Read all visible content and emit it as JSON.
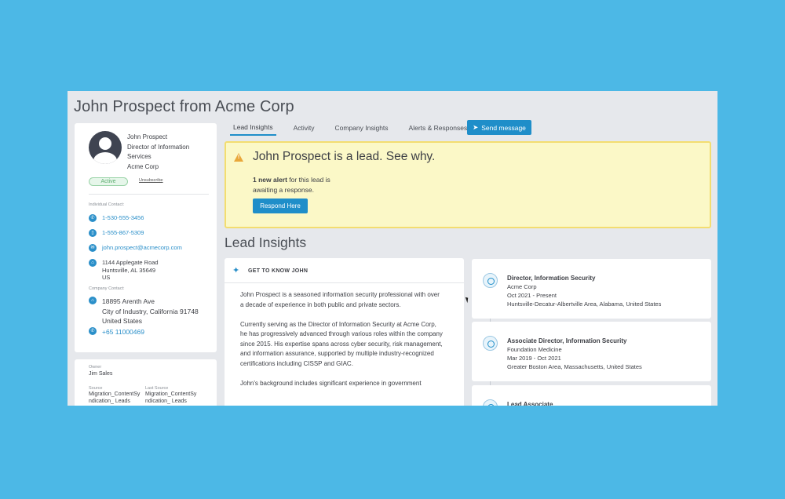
{
  "header": {
    "title": "John Prospect from Acme Corp"
  },
  "contact": {
    "name": "John Prospect",
    "title_line1": "Director of Information",
    "title_line2": "Services",
    "company": "Acme Corp",
    "status": "Active",
    "unsubscribe": "Unsubscribe",
    "individual_label": "Individual Contact:",
    "phone1": "1-530-555-3456",
    "phone2": "1-555-867-5309",
    "email": "john.prospect@acmecorp.com",
    "address_line1": "1144 Applegate Road",
    "address_line2": "Huntsville, AL 35649",
    "address_line3": "US",
    "company_label": "Company Contact:",
    "company_address_line1": "18895 Arenth Ave",
    "company_address_line2": "City of Industry, California 91748",
    "company_address_line3": "United States",
    "company_phone": "+65 11000469"
  },
  "owner": {
    "owner_label": "Owner",
    "owner_value": "Jim Sales",
    "source_label": "Source",
    "source_value_line1": "Migration_ContentSy",
    "source_value_line2": "ndication_ Leads",
    "last_source_label": "Last Source",
    "last_source_value_line1": "Migration_ContentSy",
    "last_source_value_line2": "ndication_ Leads"
  },
  "tabs": [
    {
      "label": "Lead Insights"
    },
    {
      "label": "Activity"
    },
    {
      "label": "Company Insights"
    },
    {
      "label": "Alerts & Responses"
    }
  ],
  "send_button": "Send message",
  "alert": {
    "title": "John Prospect is a lead. See why.",
    "count_bold": "1 new alert",
    "text_rest": " for this lead is awaiting a response.",
    "button": "Respond Here"
  },
  "section_title": "Lead Insights",
  "insights": {
    "header": "GET TO KNOW JOHN",
    "p1": "John Prospect is a seasoned information security professional with over a decade of experience in both public and private sectors.",
    "p2": "Currently serving as the Director of Information Security at Acme Corp, he has progressively advanced through various roles within the company since 2015. His expertise spans across cyber security, risk management, and information assurance, supported by multiple industry-recognized certifications including CISSP and GIAC.",
    "p3": "John's background includes significant experience in government"
  },
  "timeline": [
    {
      "role": "Director, Information Security",
      "company": "Acme Corp",
      "dates": "Oct 2021 - Present",
      "location": "Huntsville-Decatur-Albertville Area, Alabama, United States"
    },
    {
      "role": "Associate Director, Information Security",
      "company": "Foundation Medicine",
      "dates": "Mar 2019 - Oct 2021",
      "location": "Greater Boston Area, Massachusetts, United States"
    },
    {
      "role": "Lead Associate",
      "company": "",
      "dates": "",
      "location": ""
    }
  ]
}
